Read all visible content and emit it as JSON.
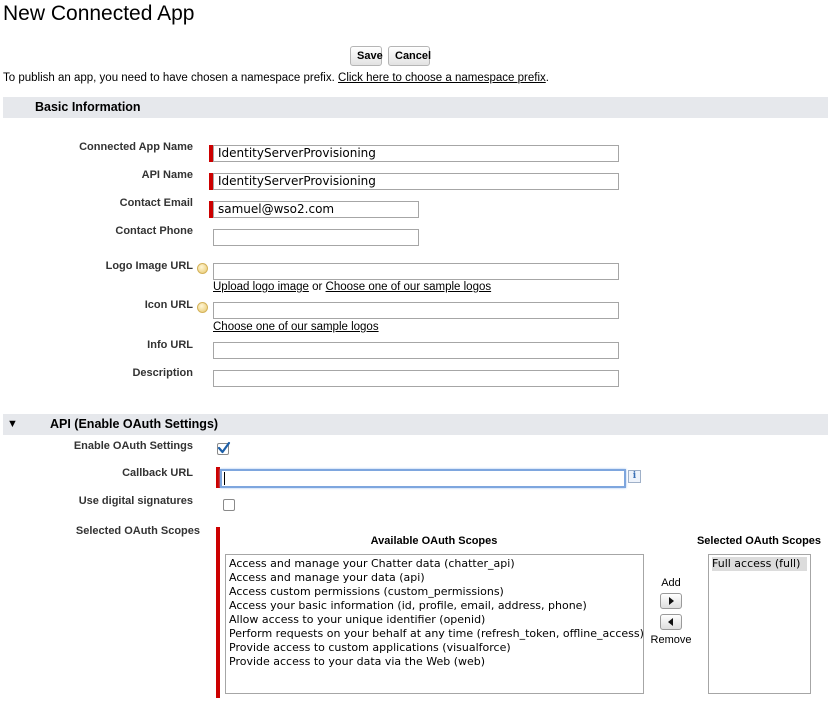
{
  "page": {
    "title": "New Connected App"
  },
  "toolbar": {
    "save_label": "Save",
    "cancel_label": "Cancel"
  },
  "notice": {
    "text": "To publish an app, you need to have chosen a namespace prefix. ",
    "link": "Click here to choose a namespace prefix",
    "suffix": "."
  },
  "basic": {
    "heading": "Basic Information",
    "connected_app_name": {
      "label": "Connected App Name",
      "value": "IdentityServerProvisioning"
    },
    "api_name": {
      "label": "API Name",
      "value": "IdentityServerProvisioning"
    },
    "contact_email": {
      "label": "Contact Email",
      "value": "samuel@wso2.com"
    },
    "contact_phone": {
      "label": "Contact Phone",
      "value": ""
    },
    "logo_image_url": {
      "label": "Logo Image URL",
      "value": "",
      "upload_link": "Upload logo image",
      "or_text": " or ",
      "sample_link": "Choose one of our sample logos"
    },
    "icon_url": {
      "label": "Icon URL",
      "value": "",
      "sample_link": "Choose one of our sample logos"
    },
    "info_url": {
      "label": "Info URL",
      "value": ""
    },
    "description": {
      "label": "Description",
      "value": ""
    }
  },
  "oauth": {
    "heading": "API (Enable OAuth Settings)",
    "enable_label": "Enable OAuth Settings",
    "enable_checked": true,
    "callback_label": "Callback URL",
    "callback_value": "",
    "digital_sig_label": "Use digital signatures",
    "digital_sig_checked": false,
    "scopes_label": "Selected OAuth Scopes",
    "available_header": "Available OAuth Scopes",
    "selected_header": "Selected OAuth Scopes",
    "add_label": "Add",
    "remove_label": "Remove",
    "available": [
      "Access and manage your Chatter data (chatter_api)",
      "Access and manage your data (api)",
      "Access custom permissions (custom_permissions)",
      "Access your basic information (id, profile, email, address, phone)",
      "Allow access to your unique identifier (openid)",
      "Perform requests on your behalf at any time (refresh_token, offline_access)",
      "Provide access to custom applications (visualforce)",
      "Provide access to your data via the Web (web)"
    ],
    "selected": [
      "Full access (full)"
    ]
  },
  "colors": {
    "required_bar": "#cc0000",
    "section_bg": "#e6e8ec",
    "check": "#1d5fa8"
  }
}
